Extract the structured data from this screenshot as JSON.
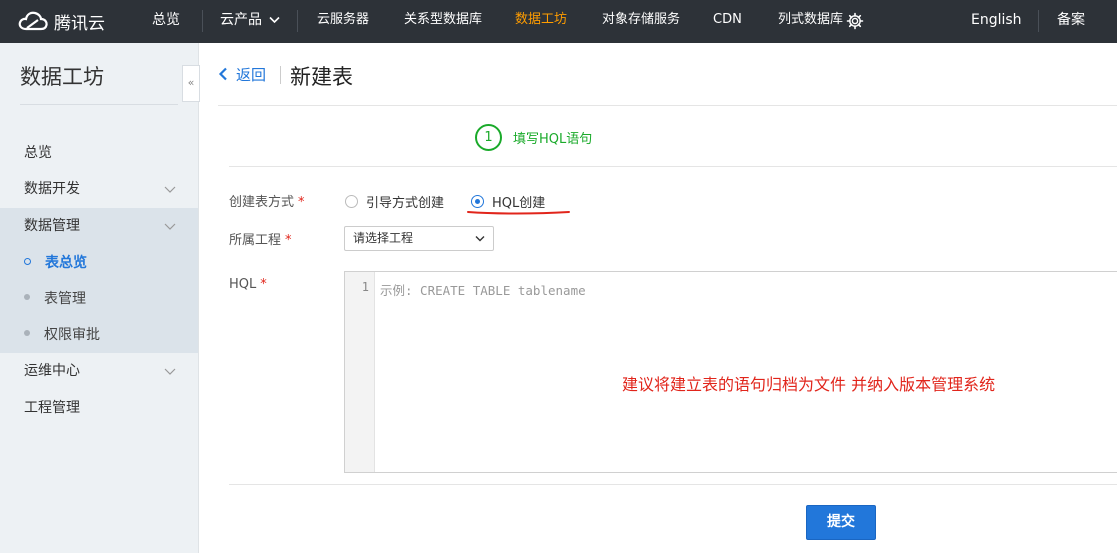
{
  "topbar": {
    "logo_text": "腾讯云",
    "nav": [
      "总览",
      "云产品",
      "云服务器",
      "关系型数据库",
      "数据工坊",
      "对象存储服务",
      "CDN",
      "列式数据库"
    ],
    "active_nav": "数据工坊",
    "language": "English",
    "record": "备案"
  },
  "sidebar": {
    "title": "数据工坊",
    "collapse_icon": "«",
    "items": {
      "overview": "总览",
      "dev": "数据开发",
      "manage": "数据管理",
      "ops": "运维中心",
      "project": "工程管理"
    },
    "sub_items": {
      "table_overview": "表总览",
      "table_manage": "表管理",
      "permission": "权限审批"
    }
  },
  "header": {
    "back": "返回",
    "title": "新建表"
  },
  "step": {
    "number": "1",
    "label": "填写HQL语句"
  },
  "form": {
    "create_method_label": "创建表方式",
    "radio_guided": "引导方式创建",
    "radio_hql": "HQL创建",
    "selected_method": "HQL创建",
    "project_label": "所属工程",
    "project_placeholder": "请选择工程",
    "hql_label": "HQL",
    "required_mark": "*",
    "line_number": "1",
    "hql_placeholder": "示例: CREATE TABLE tablename"
  },
  "annotation": "建议将建立表的语句归档为文件 并纳入版本管理系统",
  "submit_label": "提交",
  "colors": {
    "topbar_bg": "#2d3238",
    "active_nav": "#ff9d00",
    "accent": "#2277da",
    "step_green": "#1aaa2a",
    "annotation_red": "#e1251b"
  }
}
